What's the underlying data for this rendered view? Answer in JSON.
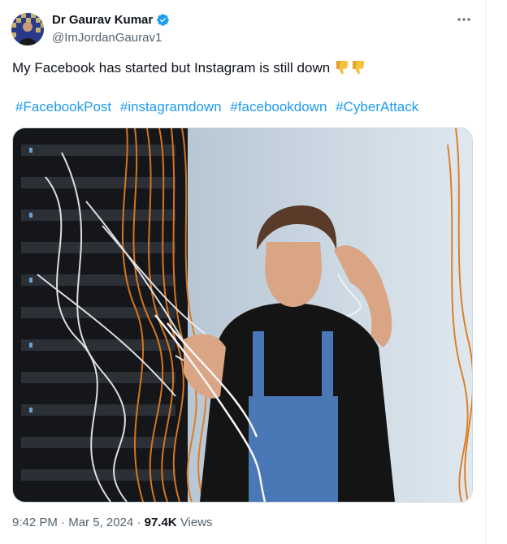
{
  "author": {
    "display_name": "Dr Gaurav Kumar",
    "handle": "@ImJordanGaurav1",
    "avatar_icon": "profile-photo"
  },
  "more_icon": "ellipsis-icon",
  "tweet": {
    "text": "My Facebook has started but Instagram is still down",
    "emojis": [
      "thumbs-down",
      "thumbs-down"
    ],
    "hashtags": [
      "#FacebookPost",
      "#instagramdown",
      "#facebookdown",
      "#CyberAttack"
    ]
  },
  "photo": {
    "subject": "man-in-overalls-untangling-cables-at-server-rack"
  },
  "meta": {
    "time": "9:42 PM",
    "separator": "·",
    "date": "Mar 5, 2024",
    "views_count": "97.4K",
    "views_label": "Views"
  },
  "colors": {
    "link": "#1d9bf0",
    "secondary": "#536471",
    "verified": "#1d9bf0"
  }
}
